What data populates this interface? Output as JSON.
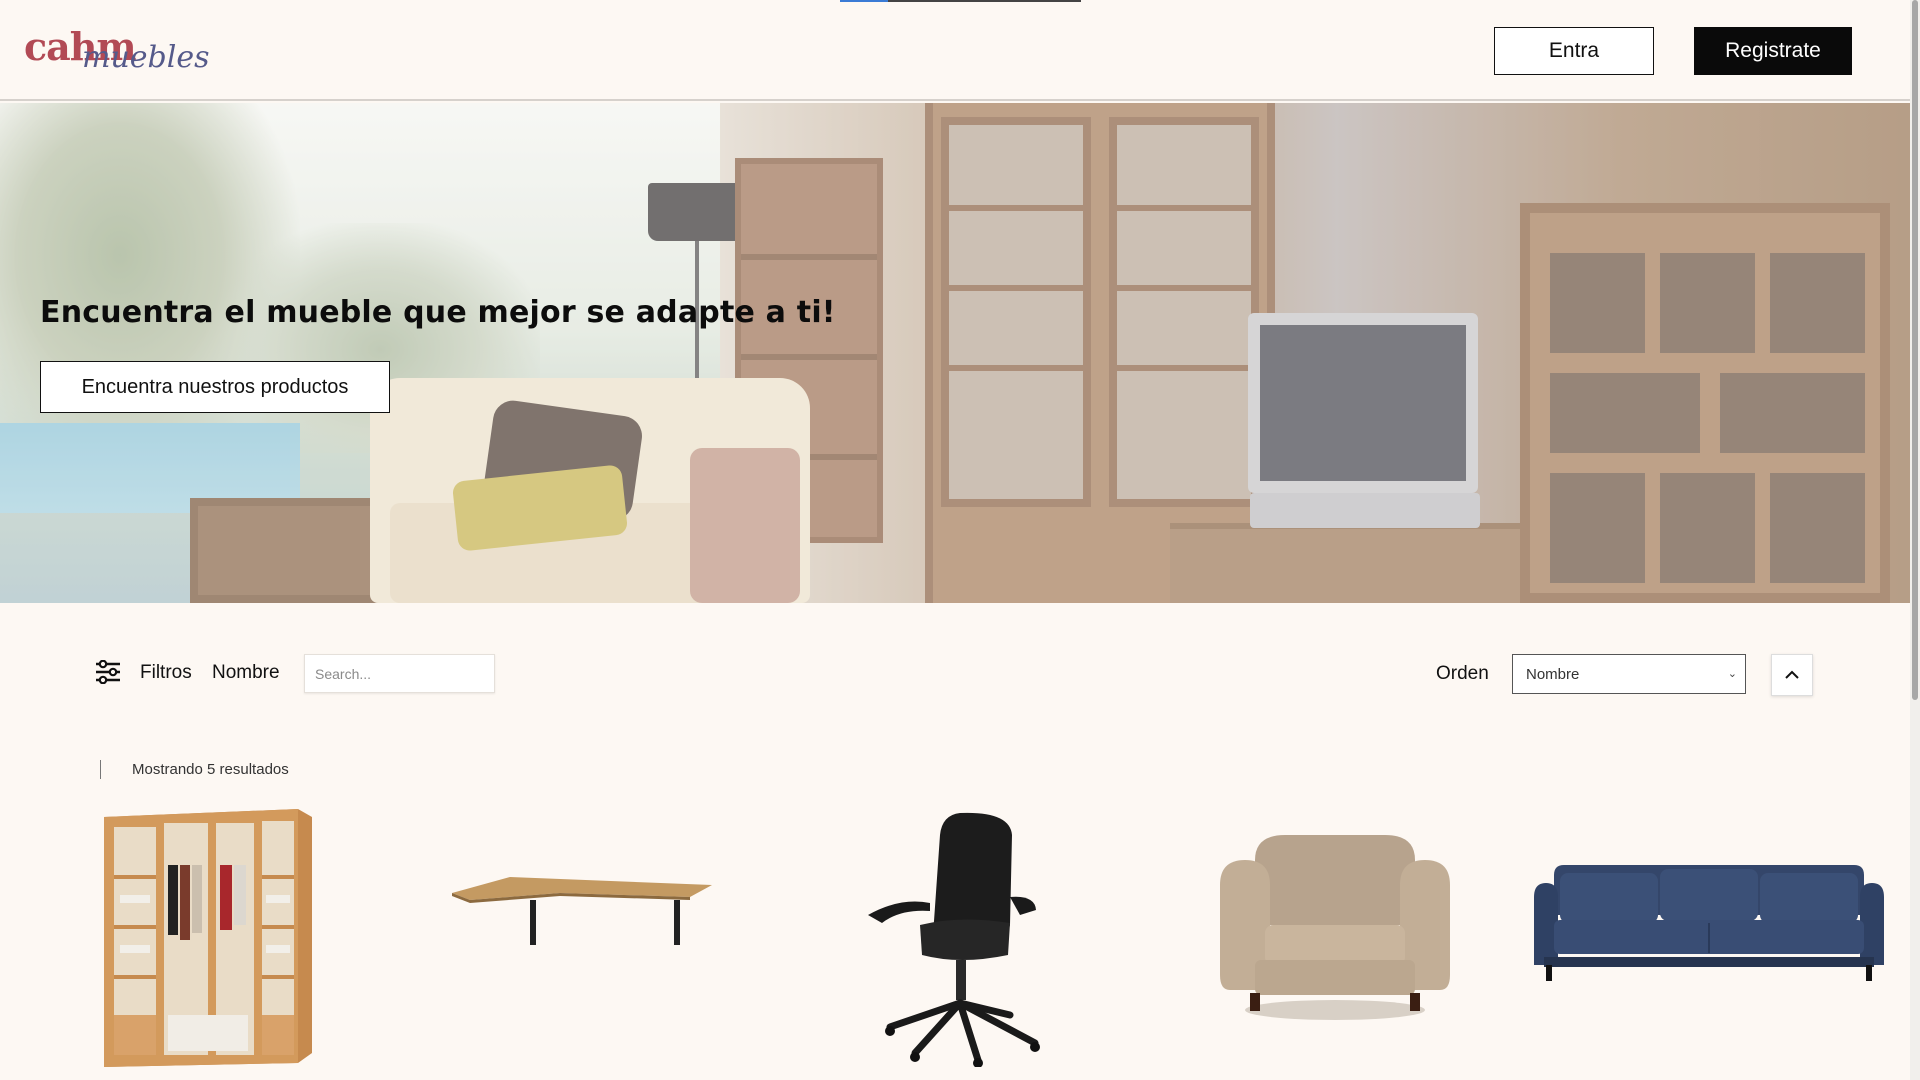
{
  "header": {
    "logo_text_main": "cahm",
    "logo_text_script": "muebles",
    "login_label": "Entra",
    "register_label": "Registrate"
  },
  "hero": {
    "title": "Encuentra el mueble que mejor se adapte a ti!",
    "cta_label": "Encuentra nuestros productos",
    "image_subject": "living-room-wooden-furniture"
  },
  "filters": {
    "filters_label": "Filtros",
    "name_label": "Nombre",
    "search_placeholder": "Search...",
    "order_label": "Orden",
    "order_selected": "Nombre",
    "sort_direction": "ascending"
  },
  "results": {
    "count_text": "Mostrando 5 resultados",
    "products": [
      {
        "image": "wardrobe"
      },
      {
        "image": "desk"
      },
      {
        "image": "office-chair"
      },
      {
        "image": "armchair"
      },
      {
        "image": "sofa"
      }
    ]
  },
  "colors": {
    "background": "#fdf8f3",
    "primary_button": "#0a0a0a",
    "accent_indicator": "#3a7bd5"
  }
}
